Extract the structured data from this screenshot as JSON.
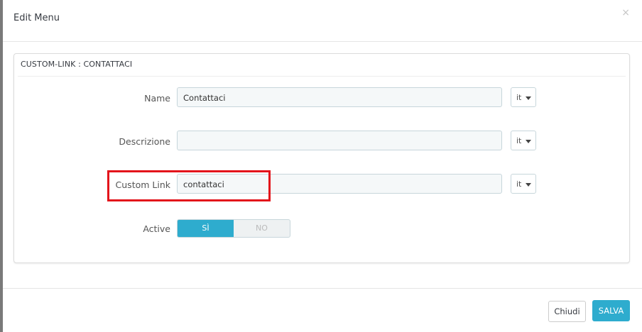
{
  "modal": {
    "title": "Edit Menu",
    "close_glyph": "×"
  },
  "panel": {
    "heading": "CUSTOM-LINK : CONTATTACI"
  },
  "fields": [
    {
      "label": "Name",
      "value": "Contattaci",
      "lang": "it"
    },
    {
      "label": "Descrizione",
      "value": "",
      "lang": "it"
    },
    {
      "label": "Custom Link",
      "value": "contattaci",
      "lang": "it"
    }
  ],
  "active": {
    "label": "Active",
    "yes_label": "SÌ",
    "no_label": "NO",
    "selected": "yes"
  },
  "footer": {
    "close_label": "Chiudi",
    "save_label": "SALVA"
  },
  "colors": {
    "accent": "#2eacce",
    "highlight": "#e3141b"
  }
}
